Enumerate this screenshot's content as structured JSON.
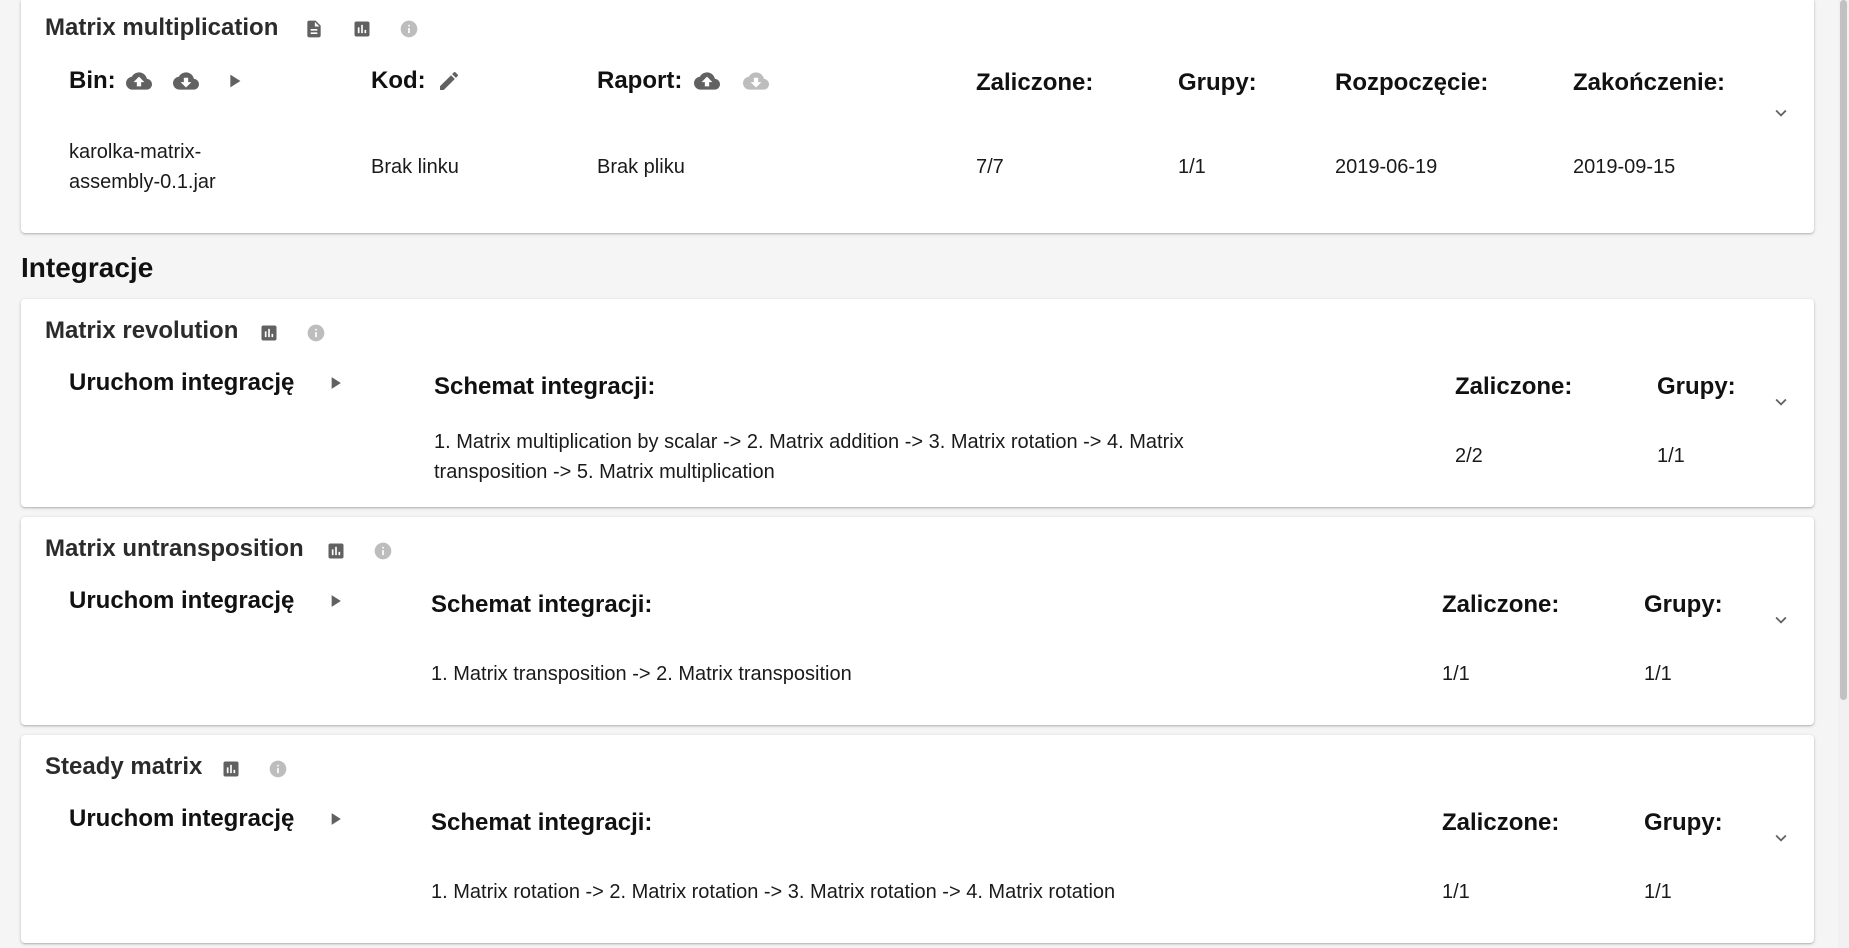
{
  "task": {
    "title": "Matrix multiplication",
    "headers": {
      "bin": "Bin:",
      "kod": "Kod:",
      "raport": "Raport:",
      "zaliczone": "Zaliczone:",
      "grupy": "Grupy:",
      "rozpoczecie": "Rozpoczęcie:",
      "zakonczenie": "Zakończenie:"
    },
    "values": {
      "bin_line1": "karolka-matrix-",
      "bin_line2": "assembly-0.1.jar",
      "kod": "Brak linku",
      "raport": "Brak pliku",
      "zaliczone": "7/7",
      "grupy": "1/1",
      "rozpoczecie": "2019-06-19",
      "zakonczenie": "2019-09-15"
    }
  },
  "integrations_heading": "Integracje",
  "integrations": [
    {
      "title": "Matrix revolution",
      "run_label": "Uruchom integrację",
      "schema_label": "Schemat integracji:",
      "zaliczone_label": "Zaliczone:",
      "grupy_label": "Grupy:",
      "schema": "1. Matrix multiplication by scalar -> 2. Matrix addition -> 3. Matrix rotation -> 4. Matrix transposition -> 5. Matrix multiplication",
      "zaliczone": "2/2",
      "grupy": "1/1"
    },
    {
      "title": "Matrix untransposition",
      "run_label": "Uruchom integrację",
      "schema_label": "Schemat integracji:",
      "zaliczone_label": "Zaliczone:",
      "grupy_label": "Grupy:",
      "schema": "1. Matrix transposition -> 2. Matrix transposition",
      "zaliczone": "1/1",
      "grupy": "1/1"
    },
    {
      "title": "Steady matrix",
      "run_label": "Uruchom integrację",
      "schema_label": "Schemat integracji:",
      "zaliczone_label": "Zaliczone:",
      "grupy_label": "Grupy:",
      "schema": "1. Matrix rotation -> 2. Matrix rotation -> 3. Matrix rotation -> 4. Matrix rotation",
      "zaliczone": "1/1",
      "grupy": "1/1"
    }
  ],
  "icons": {
    "document": "document-icon",
    "chart": "bar-chart-icon",
    "info": "info-icon",
    "upload": "cloud-upload-icon",
    "download": "cloud-download-icon",
    "play": "play-icon",
    "edit": "pencil-icon",
    "expand": "chevron-down-icon"
  },
  "colors": {
    "background": "#f5f5f5",
    "card": "#ffffff",
    "icon_dark": "#616161",
    "icon_light": "#bdbdbd",
    "text": "#1a1a1a"
  }
}
